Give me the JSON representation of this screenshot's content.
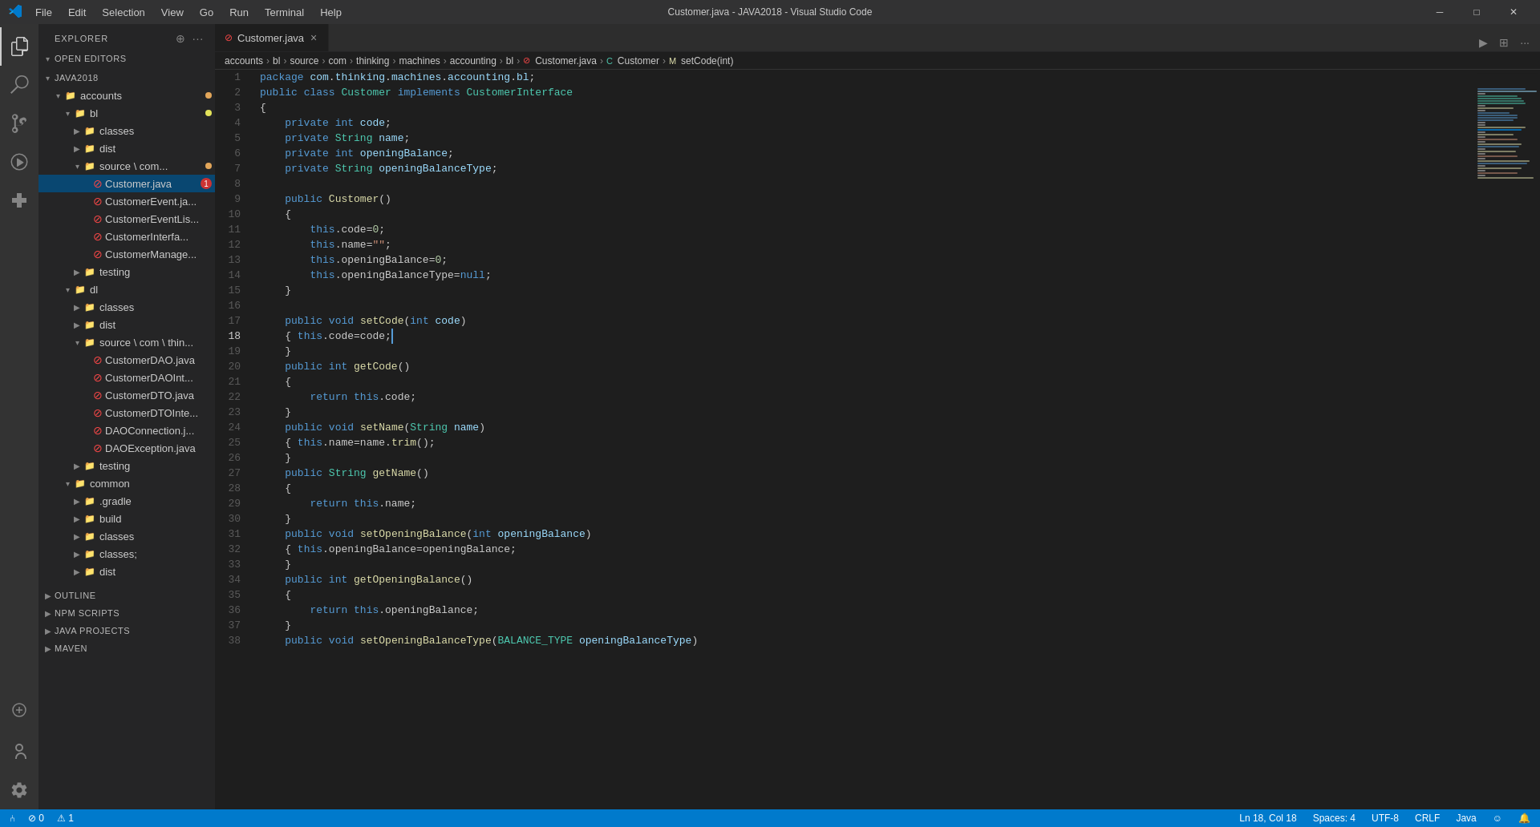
{
  "titlebar": {
    "title": "Customer.java - JAVA2018 - Visual Studio Code",
    "menu_items": [
      "File",
      "Edit",
      "Selection",
      "View",
      "Go",
      "Run",
      "Terminal",
      "Help"
    ],
    "controls": [
      "─",
      "□",
      "✕"
    ]
  },
  "sidebar": {
    "header": "EXPLORER",
    "sections": {
      "open_editors": "OPEN EDITORS",
      "project": "JAVA2018"
    },
    "tree": [
      {
        "id": "open-editors",
        "label": "OPEN EDITORS",
        "level": 0,
        "type": "section",
        "expanded": true
      },
      {
        "id": "accounts",
        "label": "accounts",
        "level": 1,
        "type": "folder",
        "expanded": true,
        "dot": "orange"
      },
      {
        "id": "bl",
        "label": "bl",
        "level": 2,
        "type": "folder",
        "expanded": true,
        "dot": "yellow"
      },
      {
        "id": "classes",
        "label": "classes",
        "level": 3,
        "type": "folder",
        "expanded": false
      },
      {
        "id": "dist",
        "label": "dist",
        "level": 3,
        "type": "folder",
        "expanded": false
      },
      {
        "id": "source-com",
        "label": "source \\ com...",
        "level": 3,
        "type": "folder",
        "expanded": true,
        "dot": "orange"
      },
      {
        "id": "customer-java",
        "label": "Customer.java",
        "level": 4,
        "type": "file",
        "error": true,
        "badge": "1",
        "selected": true
      },
      {
        "id": "customer-event-ja",
        "label": "CustomerEvent.ja...",
        "level": 4,
        "type": "file",
        "error": true
      },
      {
        "id": "customer-event-lis",
        "label": "CustomerEventLis...",
        "level": 4,
        "type": "file",
        "error": true
      },
      {
        "id": "customer-interfa",
        "label": "CustomerInterfa...",
        "level": 4,
        "type": "file",
        "error": true
      },
      {
        "id": "customer-manage",
        "label": "CustomerManage...",
        "level": 4,
        "type": "file",
        "error": true
      },
      {
        "id": "testing-1",
        "label": "testing",
        "level": 3,
        "type": "folder",
        "expanded": false
      },
      {
        "id": "dl",
        "label": "dl",
        "level": 2,
        "type": "folder",
        "expanded": true
      },
      {
        "id": "dl-classes",
        "label": "classes",
        "level": 3,
        "type": "folder",
        "expanded": false
      },
      {
        "id": "dl-dist",
        "label": "dist",
        "level": 3,
        "type": "folder",
        "expanded": false
      },
      {
        "id": "dl-source",
        "label": "source \\ com \\ thin...",
        "level": 3,
        "type": "folder",
        "expanded": true
      },
      {
        "id": "customer-dao",
        "label": "CustomerDAO.java",
        "level": 4,
        "type": "file",
        "error": true
      },
      {
        "id": "customer-dao-int",
        "label": "CustomerDAOInt...",
        "level": 4,
        "type": "file",
        "error": true
      },
      {
        "id": "customer-dto",
        "label": "CustomerDTO.java",
        "level": 4,
        "type": "file",
        "error": true
      },
      {
        "id": "customer-dto-inte",
        "label": "CustomerDTOInte...",
        "level": 4,
        "type": "file",
        "error": true
      },
      {
        "id": "dao-connection",
        "label": "DAOConnection.j...",
        "level": 4,
        "type": "file",
        "error": true
      },
      {
        "id": "dao-exception",
        "label": "DAOException.java",
        "level": 4,
        "type": "file",
        "error": true
      },
      {
        "id": "testing-2",
        "label": "testing",
        "level": 3,
        "type": "folder",
        "expanded": false
      },
      {
        "id": "common",
        "label": "common",
        "level": 2,
        "type": "folder",
        "expanded": true
      },
      {
        "id": "gradle",
        "label": ".gradle",
        "level": 3,
        "type": "folder",
        "expanded": false
      },
      {
        "id": "build",
        "label": "build",
        "level": 3,
        "type": "folder",
        "expanded": false
      },
      {
        "id": "classes2",
        "label": "classes",
        "level": 3,
        "type": "folder",
        "expanded": false
      },
      {
        "id": "classes-semi",
        "label": "classes;",
        "level": 3,
        "type": "folder",
        "expanded": false
      },
      {
        "id": "dist2",
        "label": "dist",
        "level": 3,
        "type": "folder",
        "expanded": false
      }
    ],
    "bottom_sections": [
      {
        "id": "outline",
        "label": "OUTLINE"
      },
      {
        "id": "npm-scripts",
        "label": "NPM SCRIPTS"
      },
      {
        "id": "java-projects",
        "label": "JAVA PROJECTS"
      },
      {
        "id": "maven",
        "label": "MAVEN"
      }
    ]
  },
  "tab": {
    "filename": "Customer.java",
    "has_error": true,
    "close_label": "×"
  },
  "breadcrumb": {
    "items": [
      "accounts",
      "bl",
      "source",
      "com",
      "thinking",
      "machines",
      "accounting",
      "bl",
      "Customer.java",
      "Customer",
      "setCode(int)"
    ],
    "icons": {
      "file": "⊙",
      "class": "C",
      "method": "M"
    }
  },
  "code": {
    "lines": [
      {
        "num": 1,
        "text": "package com.thinking.machines.accounting.bl;"
      },
      {
        "num": 2,
        "text": "public class Customer implements CustomerInterface"
      },
      {
        "num": 3,
        "text": "{"
      },
      {
        "num": 4,
        "text": "  private int code;"
      },
      {
        "num": 5,
        "text": "  private String name;"
      },
      {
        "num": 6,
        "text": "  private int openingBalance;"
      },
      {
        "num": 7,
        "text": "  private String openingBalanceType;"
      },
      {
        "num": 8,
        "text": ""
      },
      {
        "num": 9,
        "text": "  public Customer()"
      },
      {
        "num": 10,
        "text": "  {"
      },
      {
        "num": 11,
        "text": "    this.code=0;"
      },
      {
        "num": 12,
        "text": "    this.name=\"\";"
      },
      {
        "num": 13,
        "text": "    this.openingBalance=0;"
      },
      {
        "num": 14,
        "text": "    this.openingBalanceType=null;"
      },
      {
        "num": 15,
        "text": "  }"
      },
      {
        "num": 16,
        "text": ""
      },
      {
        "num": 17,
        "text": "  public void setCode(int code)"
      },
      {
        "num": 18,
        "text": "  { this.code=code;"
      },
      {
        "num": 19,
        "text": "  }"
      },
      {
        "num": 20,
        "text": "  public int getCode()"
      },
      {
        "num": 21,
        "text": "  {"
      },
      {
        "num": 22,
        "text": "    return this.code;"
      },
      {
        "num": 23,
        "text": "  }"
      },
      {
        "num": 24,
        "text": "  public void setName(String name)"
      },
      {
        "num": 25,
        "text": "  { this.name=name.trim();"
      },
      {
        "num": 26,
        "text": "  }"
      },
      {
        "num": 27,
        "text": "  public String getName()"
      },
      {
        "num": 28,
        "text": "  {"
      },
      {
        "num": 29,
        "text": "    return this.name;"
      },
      {
        "num": 30,
        "text": "  }"
      },
      {
        "num": 31,
        "text": "  public void setOpeningBalance(int openingBalance)"
      },
      {
        "num": 32,
        "text": "  { this.openingBalance=openingBalance;"
      },
      {
        "num": 33,
        "text": "  }"
      },
      {
        "num": 34,
        "text": "  public int getOpeningBalance()"
      },
      {
        "num": 35,
        "text": "  {"
      },
      {
        "num": 36,
        "text": "    return this.openingBalance;"
      },
      {
        "num": 37,
        "text": "  }"
      },
      {
        "num": 38,
        "text": "  public void setOpeningBalanceType(BALANCE_TYPE openingBalanceType)"
      }
    ]
  },
  "statusbar": {
    "left": {
      "errors": "⊘ 0",
      "warnings": "⚠ 1"
    },
    "right": {
      "cursor": "Ln 18, Col 18",
      "spaces": "Spaces: 4",
      "encoding": "UTF-8",
      "line_ending": "CRLF",
      "language": "Java",
      "feedback": "☺",
      "notifications": "🔔"
    }
  }
}
